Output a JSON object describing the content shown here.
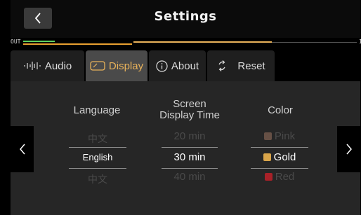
{
  "header": {
    "title": "Settings",
    "back_icon": "chevron-left-icon"
  },
  "meters": {
    "out_label": "OUT",
    "in_label": "IN",
    "out_level": 0.09,
    "in_level": 0.62
  },
  "tabs": [
    {
      "label": "Audio",
      "icon": "waveform-icon",
      "active": false
    },
    {
      "label": "Display",
      "icon": "display-icon",
      "active": true
    },
    {
      "label": "About",
      "icon": "info-icon",
      "active": false
    },
    {
      "label": "Reset",
      "icon": "reset-icon",
      "active": false
    }
  ],
  "columns": {
    "language": {
      "header": "Language",
      "prev": "中文",
      "selected": "English",
      "next": "中文"
    },
    "screen_time": {
      "header_line1": "Screen",
      "header_line2": "Display Time",
      "prev": "20 min",
      "selected": "30 min",
      "next": "40 min"
    },
    "color": {
      "header": "Color",
      "prev": {
        "label": "Pink",
        "swatch": "#e0a080"
      },
      "selected": {
        "label": "Gold",
        "swatch": "#d9a54a"
      },
      "next": {
        "label": "Red",
        "swatch": "#e0202a"
      }
    }
  },
  "nav": {
    "prev_icon": "chevron-left-icon",
    "next_icon": "chevron-right-icon"
  },
  "colors": {
    "accent": "#e8b25a",
    "active_tab": "#4a4a4a",
    "panel": "#262626"
  }
}
